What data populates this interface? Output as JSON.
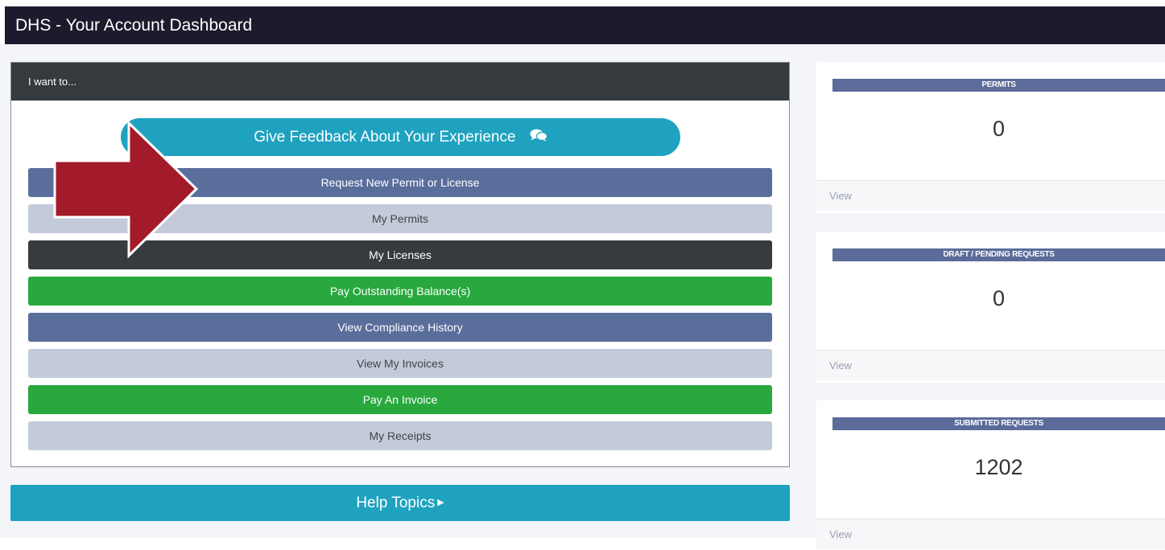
{
  "window": {
    "title": "DHS - Your Account Dashboard"
  },
  "panel": {
    "header": "I want to...",
    "feedback_button": "Give Feedback About Your Experience",
    "feedback_icon": "chat-bubbles-icon",
    "actions": [
      {
        "label": "Request New Permit or License",
        "color": "#5a6e9c",
        "text_color": "#ffffff"
      },
      {
        "label": "My Permits",
        "color": "#c3cbdb",
        "text_color": "#444444"
      },
      {
        "label": "My Licenses",
        "color": "#353b3f",
        "text_color": "#ffffff"
      },
      {
        "label": "Pay Outstanding Balance(s)",
        "color": "#28a83d",
        "text_color": "#ffffff"
      },
      {
        "label": "View Compliance History",
        "color": "#5a6e9c",
        "text_color": "#ffffff"
      },
      {
        "label": "View My Invoices",
        "color": "#c3cbdb",
        "text_color": "#444444"
      },
      {
        "label": "Pay An Invoice",
        "color": "#28a83d",
        "text_color": "#ffffff"
      },
      {
        "label": "My Receipts",
        "color": "#c3cbdb",
        "text_color": "#444444"
      }
    ]
  },
  "help": {
    "label": "Help Topics",
    "icon": "caret-right-icon"
  },
  "stats": [
    {
      "title": "PERMITS",
      "value": "0",
      "link": "View"
    },
    {
      "title": "DRAFT / PENDING REQUESTS",
      "value": "0",
      "link": "View"
    },
    {
      "title": "SUBMITTED REQUESTS",
      "value": "1202",
      "link": "View"
    }
  ],
  "annotation": {
    "icon": "red-arrow-icon",
    "color": "#a31b2a"
  }
}
